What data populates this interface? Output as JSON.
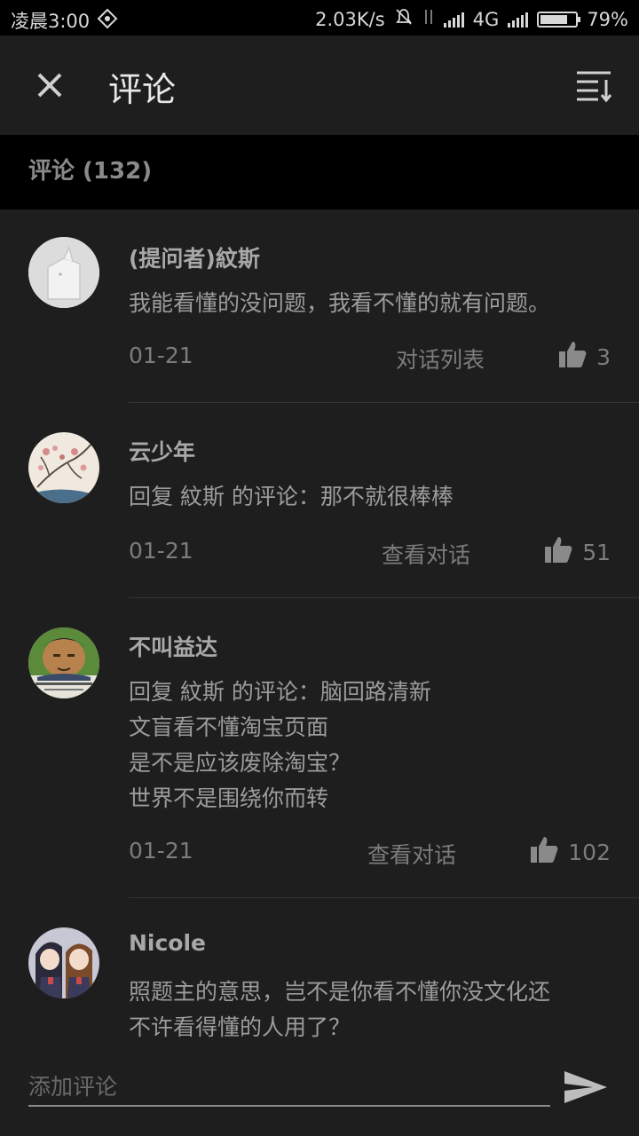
{
  "status_bar": {
    "time": "凌晨3:00",
    "speed": "2.03K/s",
    "network": "4G",
    "battery": "79%",
    "battery_level": 0.79
  },
  "header": {
    "title": "评论",
    "close_icon": "close-icon",
    "sort_icon": "sort-icon"
  },
  "section": {
    "title": "评论 (132)"
  },
  "comments": [
    {
      "author": "(提问者)紋斯",
      "lines": [
        "我能看懂的没问题，我看不懂的就有问题。"
      ],
      "date": "01-21",
      "action": "对话列表",
      "likes": "3"
    },
    {
      "author": "云少年",
      "lines": [
        "回复 紋斯 的评论：那不就很棒棒"
      ],
      "date": "01-21",
      "action": "查看对话",
      "likes": "51"
    },
    {
      "author": "不叫益达",
      "lines": [
        "回复 紋斯 的评论：脑回路清新",
        "文盲看不懂淘宝页面",
        "是不是应该废除淘宝？",
        "世界不是围绕你而转"
      ],
      "date": "01-21",
      "action": "查看对话",
      "likes": "102"
    },
    {
      "author": "Nicole",
      "lines": [
        "照题主的意思，岂不是你看不懂你没文化还",
        "不许看得懂的人用了？"
      ]
    }
  ],
  "composer": {
    "placeholder": "添加评论",
    "send_icon": "send-icon"
  },
  "colors": {
    "background": "#1e1e1e",
    "section_bar": "#000000",
    "text": "#9a9a9a"
  }
}
